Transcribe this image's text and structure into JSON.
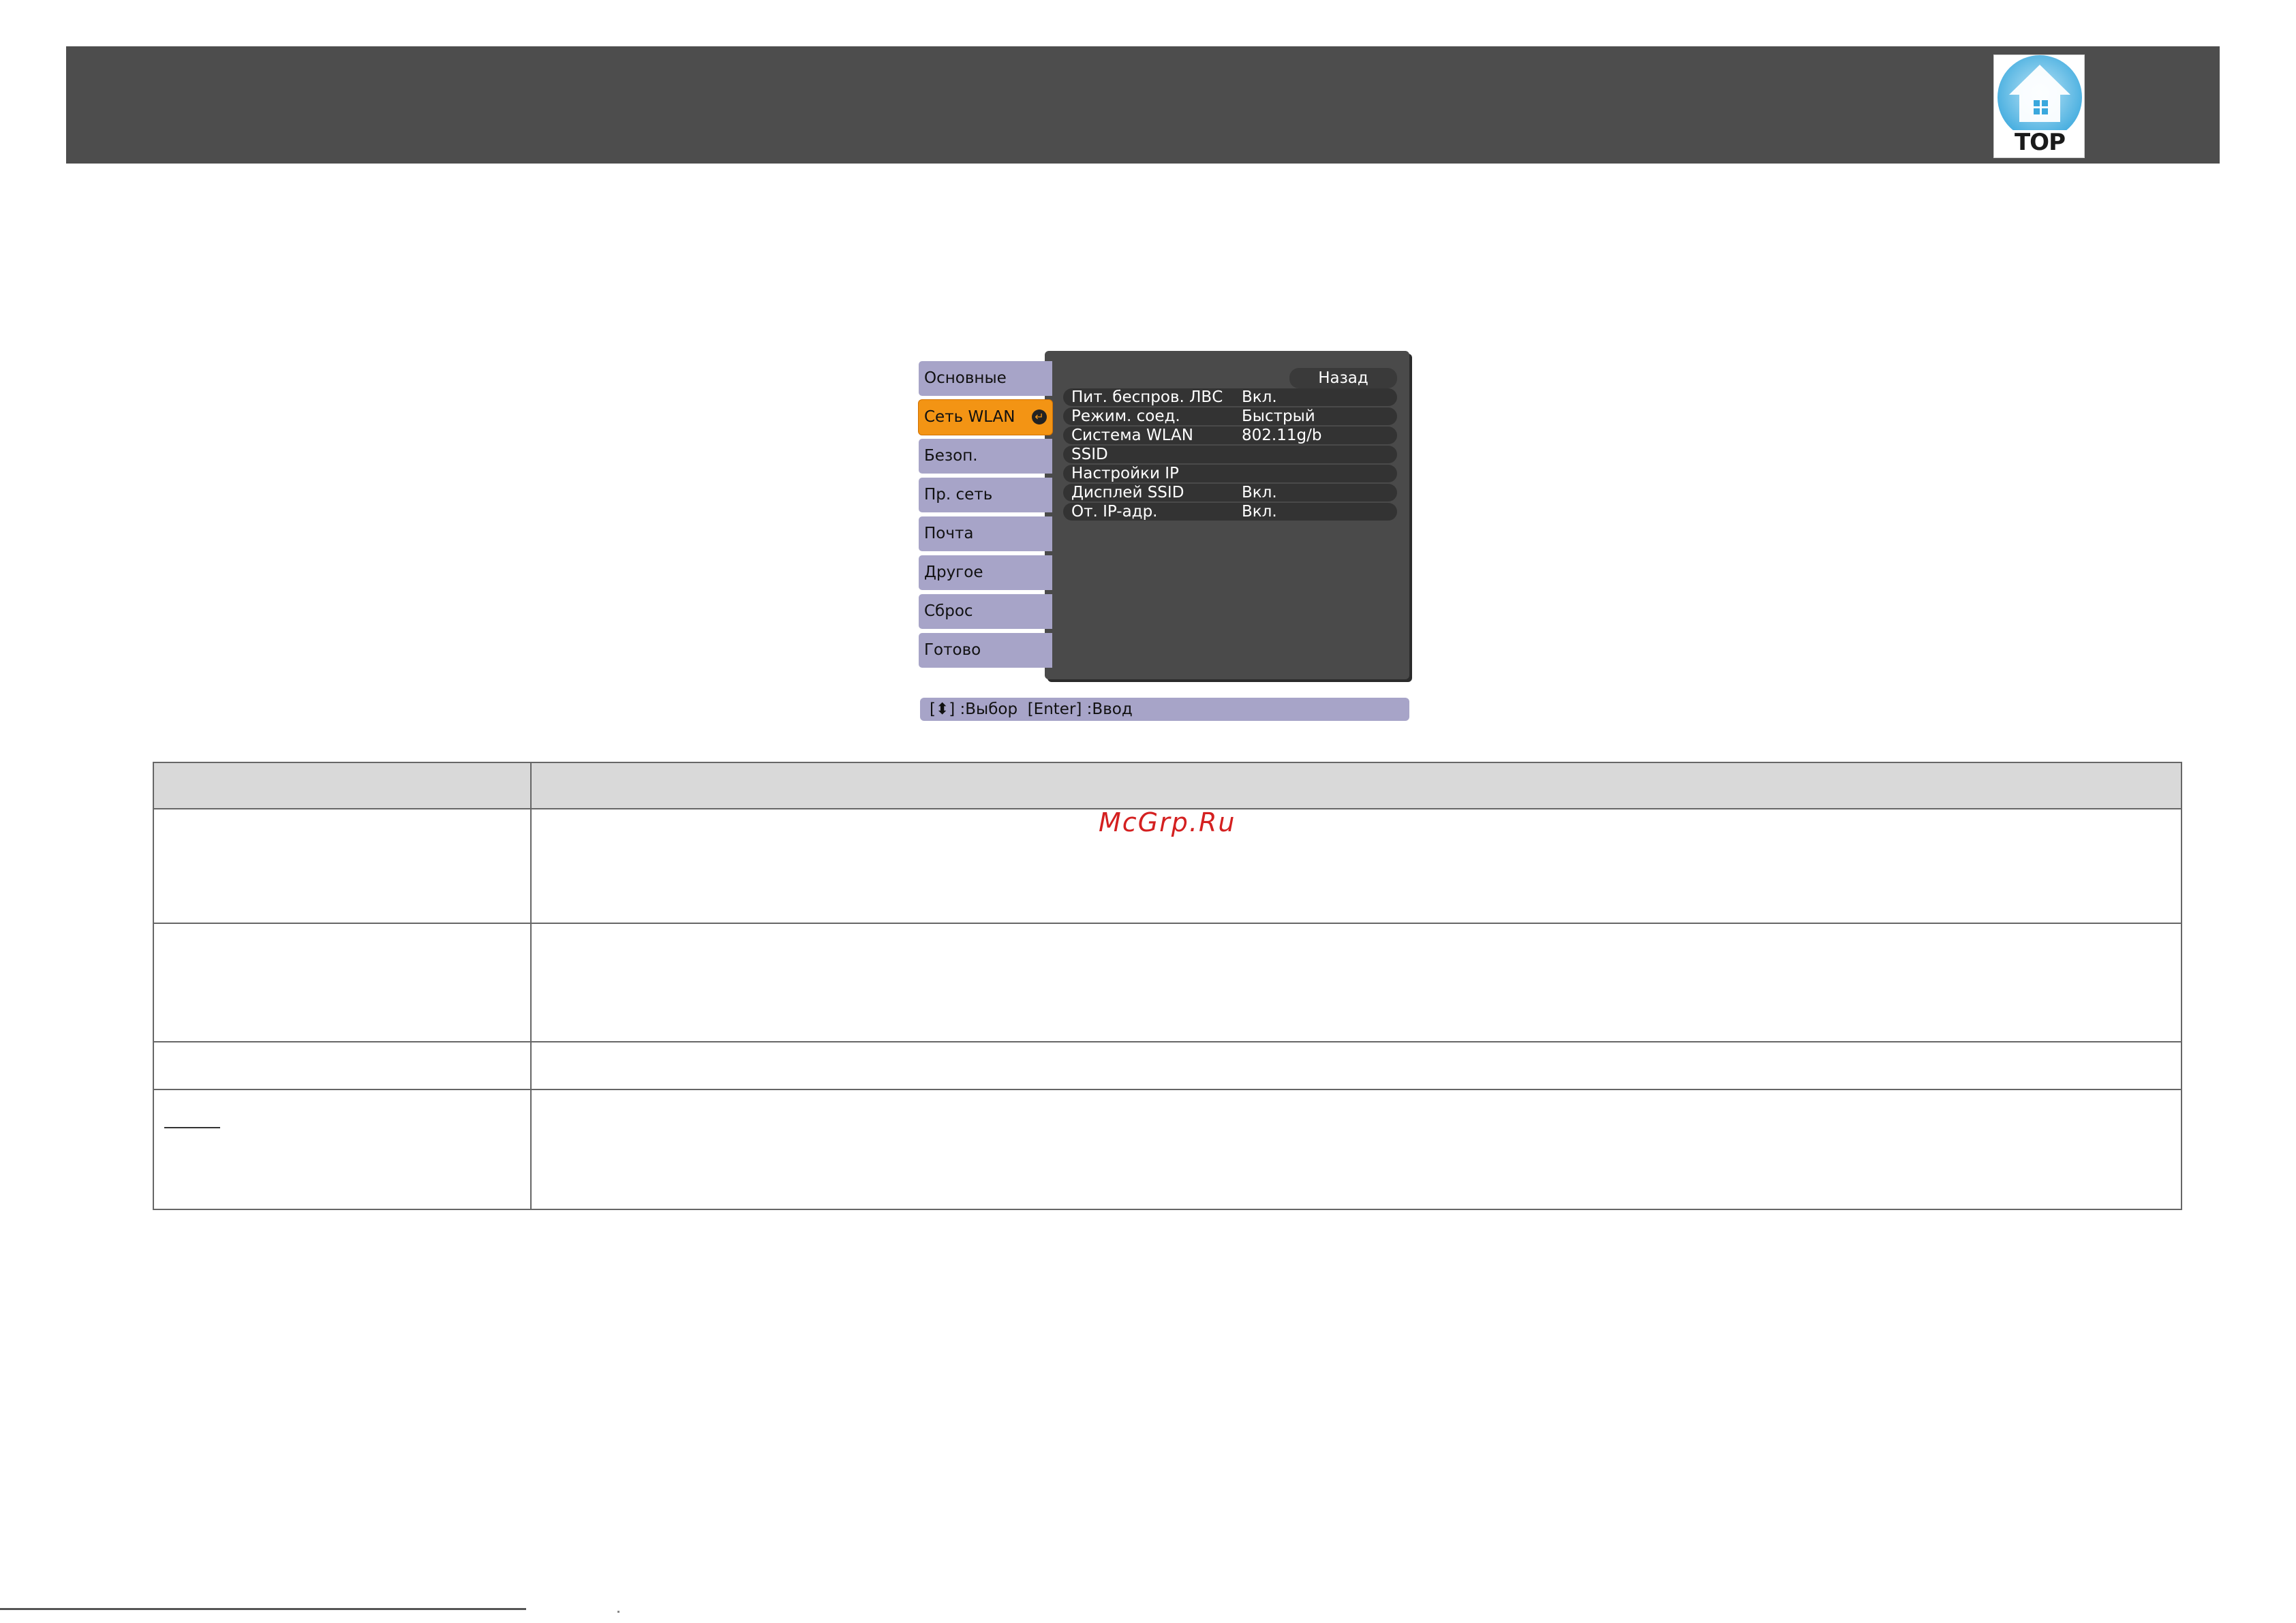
{
  "header": {
    "top_button_label": "TOP"
  },
  "osd_menu": {
    "tabs": [
      {
        "label": "Основные",
        "active": false
      },
      {
        "label": "Сеть WLAN",
        "active": true
      },
      {
        "label": "Безоп.",
        "active": false
      },
      {
        "label": "Пр. сеть",
        "active": false
      },
      {
        "label": "Почта",
        "active": false
      },
      {
        "label": "Другое",
        "active": false
      },
      {
        "label": "Сброс",
        "active": false
      },
      {
        "label": "Готово",
        "active": false
      }
    ],
    "back_label": "Назад",
    "rows": [
      {
        "label": "Пит. беспров. ЛВС",
        "value": "Вкл."
      },
      {
        "label": "Режим. соед.",
        "value": "Быстрый"
      },
      {
        "label": "Система WLAN",
        "value": "802.11g/b"
      },
      {
        "label": "SSID",
        "value": ""
      },
      {
        "label": "Настройки IP",
        "value": ""
      },
      {
        "label": "Дисплей SSID",
        "value": "Вкл."
      },
      {
        "label": "От. IP-адр.",
        "value": "Вкл."
      }
    ],
    "hint": "[⬍] :Выбор  [Enter] :Ввод",
    "colors": {
      "panel": "#4a4a4a",
      "tab": "#a7a4c8",
      "active_tab": "#f39414"
    }
  },
  "watermark": "McGrp.Ru",
  "settings_table": {
    "header": [
      "",
      ""
    ],
    "rows": [
      [
        "",
        ""
      ],
      [
        "",
        ""
      ],
      [
        "",
        ""
      ],
      [
        "",
        ""
      ]
    ]
  },
  "icons": {
    "top": "home-top-icon",
    "enter": "enter-icon"
  }
}
